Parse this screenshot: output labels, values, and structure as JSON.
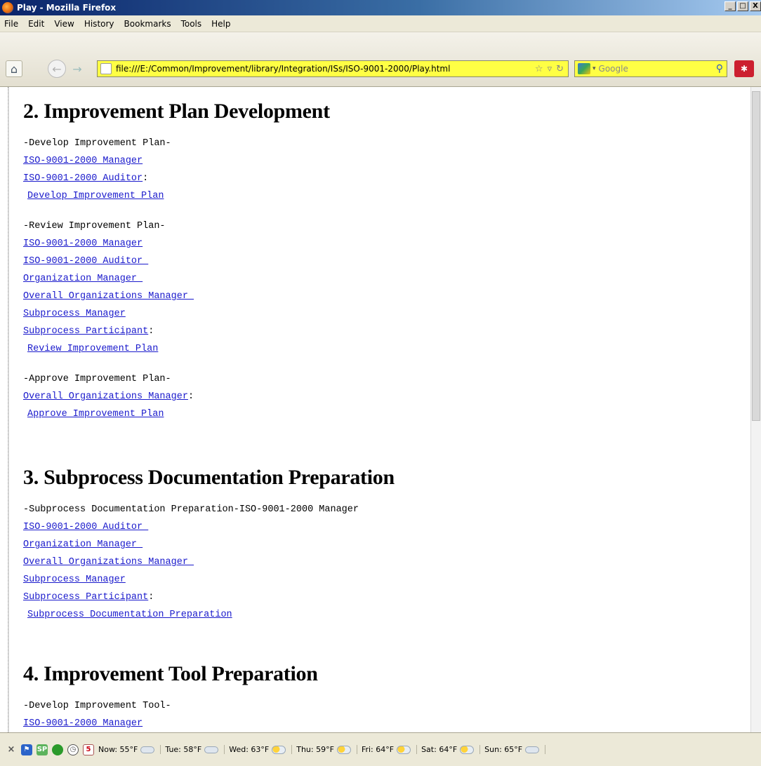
{
  "window": {
    "title": "Play - Mozilla Firefox",
    "controls": [
      "_",
      "□",
      "X"
    ]
  },
  "menu": [
    "File",
    "Edit",
    "View",
    "History",
    "Bookmarks",
    "Tools",
    "Help"
  ],
  "nav": {
    "url": "file:///E:/Common/Improvement/library/Integration/ISs/ISO-9001-2000/Play.html",
    "search_placeholder": "Google"
  },
  "content": {
    "sections": [
      {
        "title": "2. Improvement Plan Development",
        "lines": [
          {
            "text": "-Develop Improvement Plan-",
            "type": "hdr"
          },
          {
            "text": "ISO-9001-2000 Manager",
            "type": "link"
          },
          {
            "text": "ISO-9001-2000 Auditor",
            "type": "link",
            "suffix": ":"
          },
          {
            "text": "Develop Improvement Plan",
            "type": "link",
            "indent": true
          },
          {
            "text": "-Review Improvement Plan-",
            "type": "hdr"
          },
          {
            "text": "ISO-9001-2000 Manager",
            "type": "link"
          },
          {
            "text": "ISO-9001-2000 Auditor ",
            "type": "link"
          },
          {
            "text": "Organization Manager ",
            "type": "link"
          },
          {
            "text": "Overall Organizations Manager ",
            "type": "link"
          },
          {
            "text": "Subprocess Manager",
            "type": "link"
          },
          {
            "text": "Subprocess Participant",
            "type": "link",
            "suffix": ":"
          },
          {
            "text": "Review Improvement Plan",
            "type": "link",
            "indent": true
          },
          {
            "text": "-Approve Improvement Plan-",
            "type": "hdr"
          },
          {
            "text": "Overall Organizations Manager",
            "type": "link",
            "suffix": ":"
          },
          {
            "text": "Approve Improvement Plan",
            "type": "link",
            "indent": true
          }
        ]
      },
      {
        "title": "3. Subprocess Documentation Preparation",
        "lines": [
          {
            "text": "-Subprocess Documentation Preparation-ISO-9001-2000 Manager",
            "type": "hdr"
          },
          {
            "text": "ISO-9001-2000 Auditor ",
            "type": "link"
          },
          {
            "text": "Organization Manager ",
            "type": "link"
          },
          {
            "text": "Overall Organizations Manager ",
            "type": "link"
          },
          {
            "text": "Subprocess Manager",
            "type": "link"
          },
          {
            "text": "Subprocess Participant",
            "type": "link",
            "suffix": ":"
          },
          {
            "text": "Subprocess Documentation Preparation",
            "type": "link",
            "indent": true
          }
        ]
      },
      {
        "title": "4. Improvement Tool Preparation",
        "lines": [
          {
            "text": "-Develop Improvement Tool-",
            "type": "hdr"
          },
          {
            "text": "ISO-9001-2000 Manager",
            "type": "link"
          }
        ]
      }
    ]
  },
  "statusbar": {
    "weather": [
      {
        "label": "Now: 55°F",
        "icon": "cloud-icon"
      },
      {
        "label": "Tue: 58°F",
        "icon": "cloud-icon"
      },
      {
        "label": "Wed: 63°F",
        "icon": "partly-cloudy-icon"
      },
      {
        "label": "Thu: 59°F",
        "icon": "partly-cloudy-icon"
      },
      {
        "label": "Fri: 64°F",
        "icon": "partly-cloudy-icon"
      },
      {
        "label": "Sat: 64°F",
        "icon": "partly-cloudy-icon"
      },
      {
        "label": "Sun: 65°F",
        "icon": "cloud-icon"
      }
    ],
    "calendar_day": "5",
    "sp_label": "SP"
  }
}
